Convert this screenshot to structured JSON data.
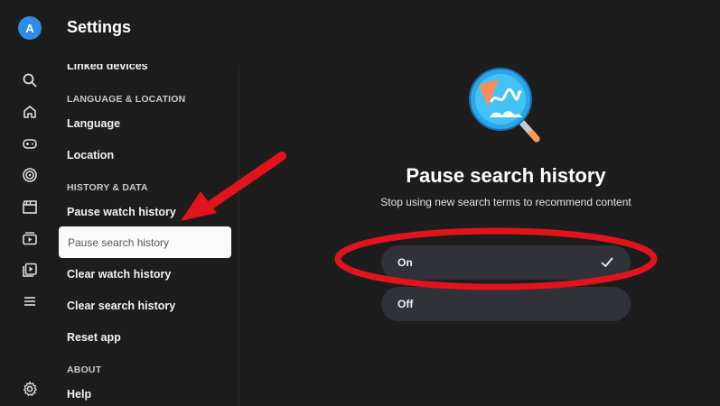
{
  "header": {
    "avatar_letter": "A",
    "title": "Settings"
  },
  "rail": {
    "icons": [
      "search-icon",
      "home-icon",
      "gamepad-icon",
      "target-icon",
      "clapperboard-icon",
      "subscriptions-icon",
      "library-icon",
      "menu-icon",
      "gear-icon"
    ]
  },
  "menu": {
    "partial_top": "Linked devices",
    "section_language": "LANGUAGE & LOCATION",
    "language": "Language",
    "location": "Location",
    "section_history": "HISTORY & DATA",
    "pause_watch": "Pause watch history",
    "pause_search": "Pause search history",
    "clear_watch": "Clear watch history",
    "clear_search": "Clear search history",
    "reset_app": "Reset app",
    "section_about": "ABOUT",
    "help": "Help"
  },
  "panel": {
    "title": "Pause search history",
    "subtitle": "Stop using new search terms to recommend content",
    "options": [
      {
        "label": "On",
        "selected": true
      },
      {
        "label": "Off",
        "selected": false
      }
    ]
  },
  "colors": {
    "accent_blue": "#2d8de2",
    "annotation_red": "#e2141b"
  }
}
